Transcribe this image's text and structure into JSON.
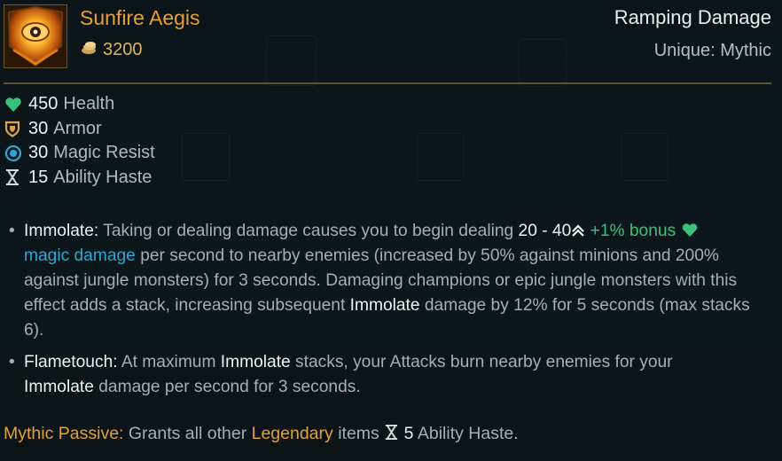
{
  "item": {
    "name": "Sunfire Aegis",
    "cost": "3200",
    "type": "Ramping Damage",
    "rarity": "Unique: Mythic"
  },
  "stats": [
    {
      "value": "450",
      "label": "Health",
      "icon": "heart-icon"
    },
    {
      "value": "30",
      "label": "Armor",
      "icon": "shield-icon"
    },
    {
      "value": "30",
      "label": "Magic Resist",
      "icon": "magic-resist-icon"
    },
    {
      "value": "15",
      "label": "Ability Haste",
      "icon": "hourglass-icon"
    }
  ],
  "passives": {
    "immolate": {
      "name": "Immolate:",
      "t1": " Taking or dealing damage causes you to begin dealing ",
      "dmg": "20 - 40",
      "bonus": " +1% bonus ",
      "magic": "magic damage",
      "t2": " per second to nearby enemies (increased by 50% against minions and 200% against jungle monsters) for 3 seconds. Damaging champions or epic jungle monsters with this effect adds a stack, increasing subsequent ",
      "kw": "Immolate",
      "t3": " damage by 12% for 5 seconds (max stacks 6)."
    },
    "flametouch": {
      "name": "Flametouch:",
      "t1": " At maximum ",
      "kw1": "Immolate",
      "t2": " stacks, your Attacks burn nearby enemies for your ",
      "kw2": "Immolate",
      "t3": " damage per second for 3 seconds."
    }
  },
  "mythic": {
    "label": "Mythic Passive:",
    "t1": " Grants all other ",
    "legendary": "Legendary",
    "t2": " items ",
    "value": "5",
    "t3": " Ability Haste."
  },
  "colors": {
    "gold": "#e6a12e",
    "green": "#3bc07a",
    "blue": "#2aa8d6",
    "white": "#eef2f2"
  }
}
